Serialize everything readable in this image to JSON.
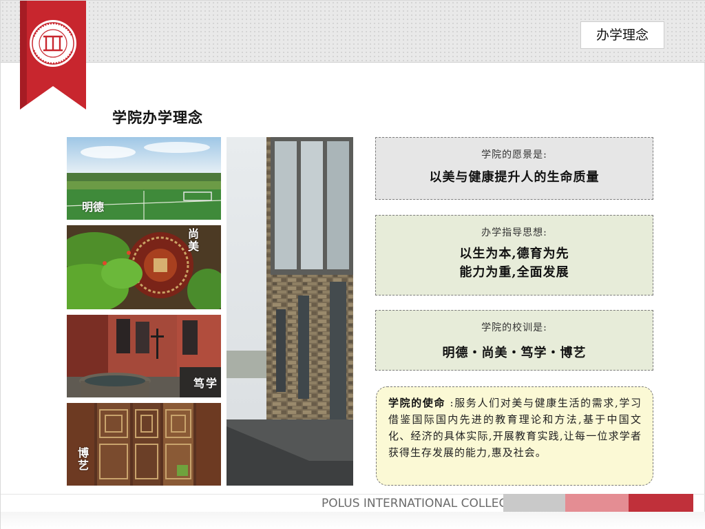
{
  "header": {
    "section_label": "办学理念"
  },
  "page": {
    "heading": "学院办学理念"
  },
  "photos": {
    "captions": [
      "明德",
      "尚美",
      "笃学",
      "博艺"
    ]
  },
  "cards": {
    "vision": {
      "label": "学院的愿景是:",
      "value": "以美与健康提升人的生命质量"
    },
    "guiding": {
      "label": "办学指导思想:",
      "line1": "以生为本,德育为先",
      "line2": "能力为重,全面发展"
    },
    "motto": {
      "label": "学院的校训是:",
      "value": "明德・尚美・笃学・博艺"
    }
  },
  "mission": {
    "title": "学院的使命",
    "text": " :服务人们对美与健康生活的需求,学习借鉴国际国内先进的教育理论和方法,基于中国文化、经济的具体实际,开展教育实践,让每一位求学者获得生存发展的能力,惠及社会。"
  },
  "footer": {
    "college_name": "POLUS INTERNATIONAL COLLEGE"
  },
  "colors": {
    "ribbon": "#c8262e",
    "card_gray": "#e6e6e6",
    "card_green": "#e7ecd9",
    "mission_bg": "#fbf9d5",
    "footer_gray": "#c9c9c9",
    "footer_pink": "#e48d93",
    "footer_red": "#c0303a"
  }
}
